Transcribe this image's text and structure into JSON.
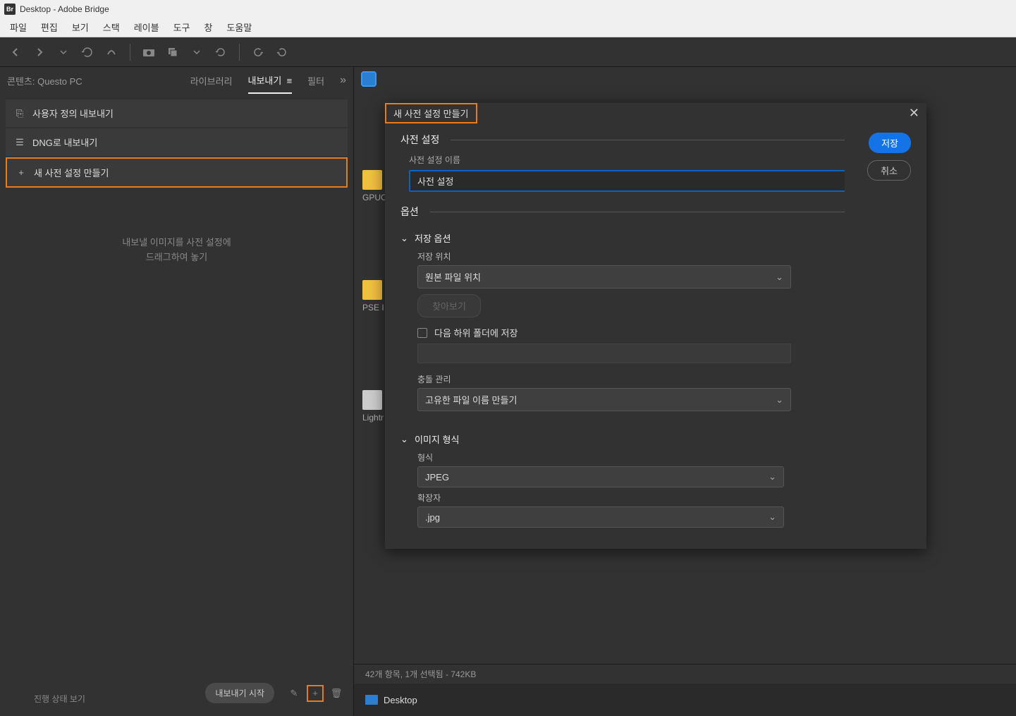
{
  "titlebar": {
    "app_badge": "Br",
    "title": "Desktop - Adobe Bridge"
  },
  "menu": {
    "file": "파일",
    "edit": "편집",
    "view": "보기",
    "stack": "스택",
    "label": "레이블",
    "tool": "도구",
    "window": "창",
    "help": "도움말"
  },
  "panel": {
    "contents_label": "콘텐츠: Questo PC",
    "tabs": {
      "library": "라이브러리",
      "export": "내보내기",
      "filter": "필터"
    },
    "more": "»"
  },
  "export_list": {
    "custom": "사용자 정의 내보내기",
    "dng": "DNG로 내보내기",
    "new_preset": "새 사전 설정 만들기"
  },
  "dragzone": {
    "line1": "내보낼 이미지를 사전 설정에",
    "line2": "드래그하여 놓기"
  },
  "left_footer": {
    "start": "내보내기 시작",
    "progress": "진행 상태 보기"
  },
  "dialog": {
    "title": "새 사전 설정 만들기",
    "section_preset": "사전 설정",
    "name_label": "사전 설정 이름",
    "name_value": "사전 설정",
    "save": "저장",
    "cancel": "취소",
    "section_options": "옵션",
    "grp_save": "저장 옵션",
    "save_loc_label": "저장 위치",
    "save_loc_value": "원본 파일 위치",
    "browse": "찾아보기",
    "subfolder_chk": "다음 하위 폴더에 저장",
    "conflict_label": "충돌 관리",
    "conflict_value": "고유한 파일 이름 만들기",
    "grp_image": "이미지 형식",
    "format_label": "형식",
    "format_value": "JPEG",
    "ext_label": "확장자",
    "ext_value": ".jpg"
  },
  "content_side": {
    "gpu": "GPUC",
    "pse": "PSE I",
    "light": "Lightr"
  },
  "status": {
    "text": "42개 항목, 1개 선택됨 - 742KB"
  },
  "path": {
    "desktop": "Desktop"
  }
}
